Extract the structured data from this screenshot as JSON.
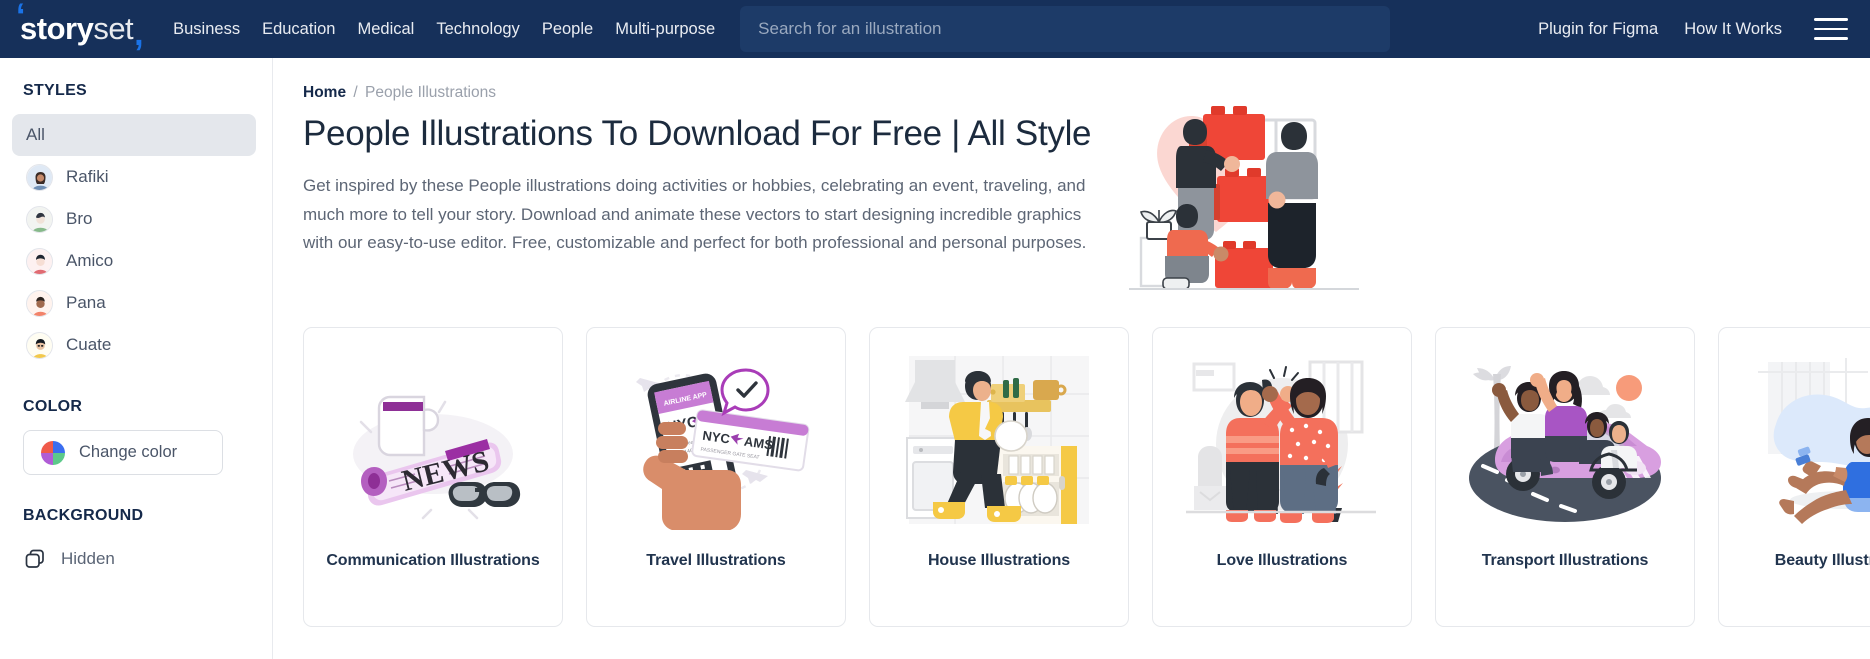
{
  "header": {
    "logo": {
      "part1": "story",
      "part2": "set",
      "quote_open": "‘",
      "quote_close": ","
    },
    "nav": [
      {
        "label": "Business"
      },
      {
        "label": "Education"
      },
      {
        "label": "Medical"
      },
      {
        "label": "Technology"
      },
      {
        "label": "People"
      },
      {
        "label": "Multi-purpose"
      }
    ],
    "search": {
      "placeholder": "Search for an illustration",
      "value": ""
    },
    "right_links": [
      {
        "label": "Plugin for Figma"
      },
      {
        "label": "How It Works"
      }
    ],
    "menu_icon": "hamburger-menu-icon",
    "background_color": "#16305a",
    "search_background": "#1d3b68"
  },
  "sidebar": {
    "styles_heading": "STYLES",
    "styles": [
      {
        "label": "All",
        "selected": true,
        "has_avatar": false
      },
      {
        "label": "Rafiki",
        "selected": false,
        "has_avatar": true
      },
      {
        "label": "Bro",
        "selected": false,
        "has_avatar": true
      },
      {
        "label": "Amico",
        "selected": false,
        "has_avatar": true
      },
      {
        "label": "Pana",
        "selected": false,
        "has_avatar": true
      },
      {
        "label": "Cuate",
        "selected": false,
        "has_avatar": true
      }
    ],
    "color_heading": "COLOR",
    "change_color_label": "Change color",
    "change_color_icon": "color-wheel-icon",
    "background_heading": "BACKGROUND",
    "background_option_label": "Hidden",
    "background_option_icon": "layers-icon",
    "selected_pill_color": "#e4e7ec"
  },
  "main": {
    "breadcrumb": {
      "home": "Home",
      "separator": "/",
      "current": "People Illustrations"
    },
    "title": "People Illustrations To Download For Free | All Style",
    "description": "Get inspired by these People illustrations doing activities or hobbies, celebrating an event, traveling, and much more to tell your story. Download and animate these vectors to start designing incredible graphics with our easy-to-use editor. Free, customizable and perfect for both professional and personal purposes.",
    "hero_illustration": "people-stacking-boxes-illustration",
    "cards": [
      {
        "label": "Communication Illustrations",
        "thumb": "newspaper-coffee-glasses-illustration"
      },
      {
        "label": "Travel Illustrations",
        "thumb": "hand-phone-boarding-pass-illustration"
      },
      {
        "label": "House Illustrations",
        "thumb": "man-loading-dishwasher-illustration"
      },
      {
        "label": "Love Illustrations",
        "thumb": "two-women-high-five-illustration"
      },
      {
        "label": "Transport Illustrations",
        "thumb": "convertible-car-friends-illustration"
      },
      {
        "label": "Beauty Illustrations",
        "thumb": "woman-shaving-leg-illustration"
      }
    ]
  },
  "colors": {
    "navy": "#16305a",
    "accent_blue": "#1a73e8",
    "text_dark": "#1c2b3e",
    "text_muted": "#5d6675",
    "border": "#e6e8ec"
  }
}
